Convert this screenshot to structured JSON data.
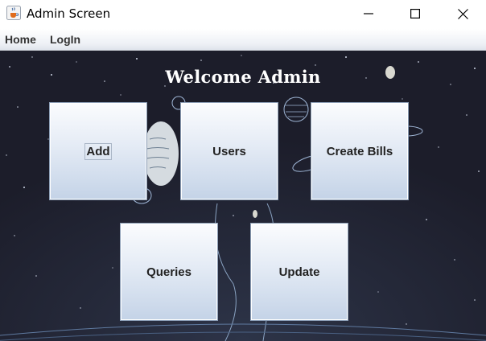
{
  "window": {
    "title": "Admin Screen"
  },
  "menu": {
    "items": [
      {
        "label": "Home"
      },
      {
        "label": "LogIn"
      }
    ]
  },
  "main": {
    "heading": "Welcome Admin",
    "buttons": [
      {
        "label": "Add"
      },
      {
        "label": "Users"
      },
      {
        "label": "Create Bills"
      },
      {
        "label": "Queries"
      },
      {
        "label": "Update"
      }
    ]
  },
  "icons": {
    "app": "java-cup-icon",
    "minimize": "minimize-icon",
    "maximize": "maximize-icon",
    "close": "close-icon"
  },
  "colors": {
    "background": "#1e1f2c",
    "tile_top": "#fbfcfe",
    "tile_bottom": "#c4d3e7"
  }
}
